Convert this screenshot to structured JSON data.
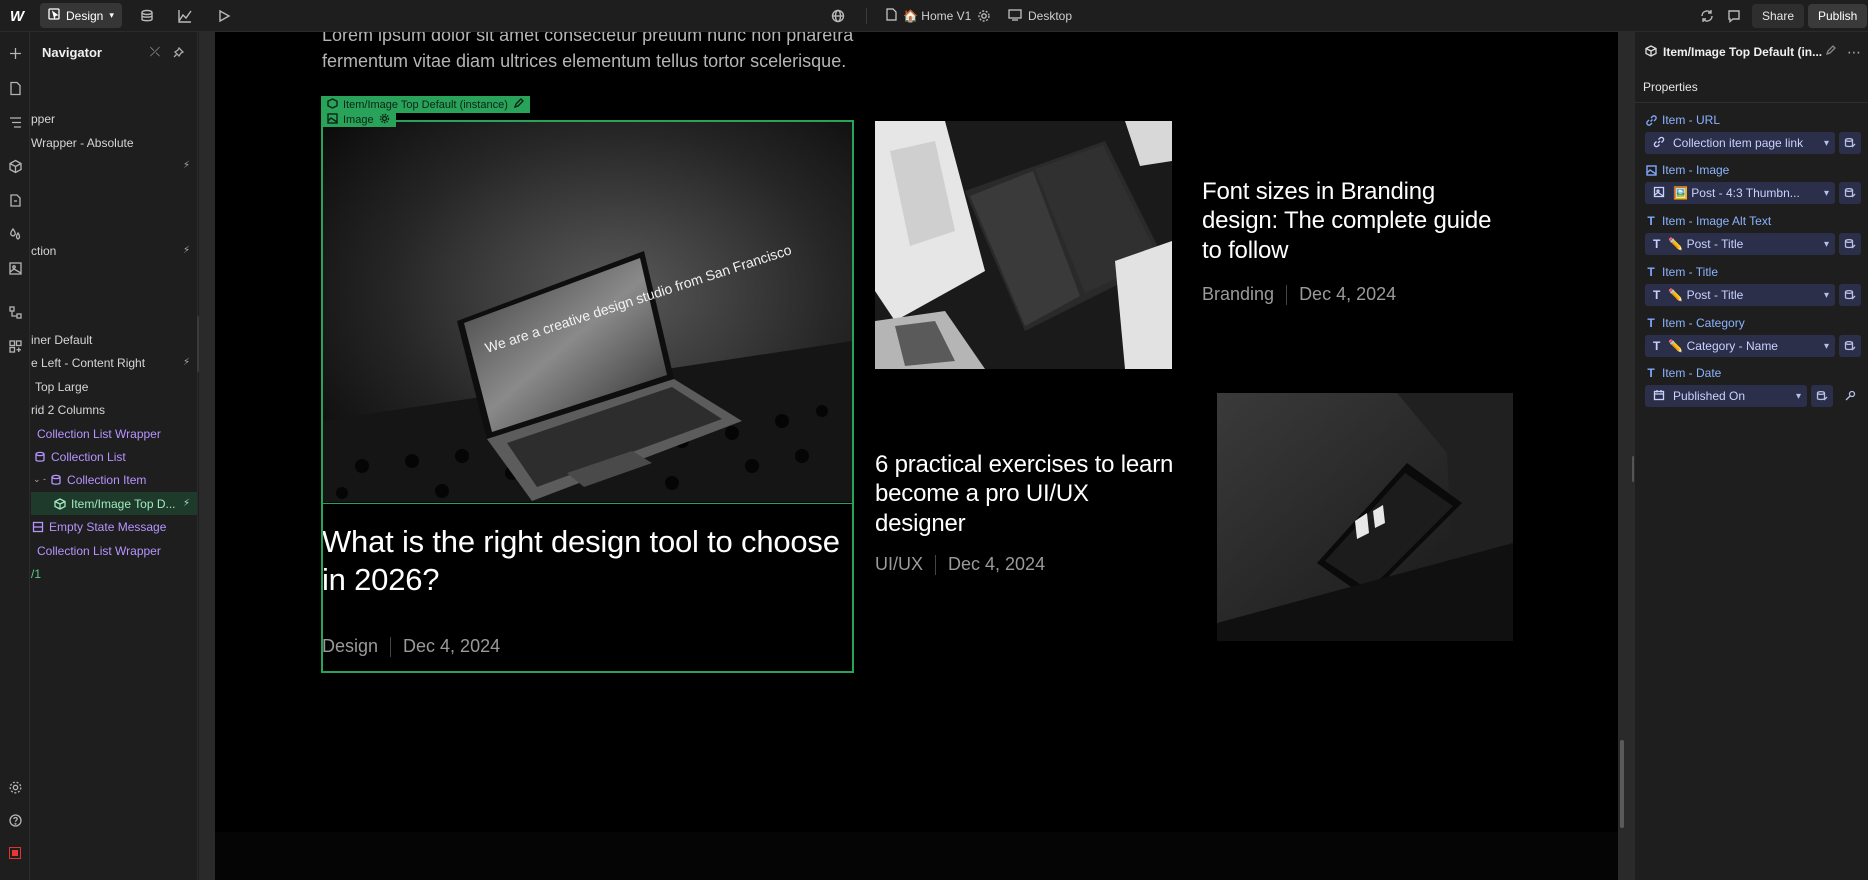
{
  "topbar": {
    "mode_label": "Design",
    "page_label": "🏠 Home V1",
    "breakpoint_label": "Desktop",
    "share_label": "Share",
    "publish_label": "Publish"
  },
  "navigator": {
    "title": "Navigator",
    "items": [
      {
        "label": "pper"
      },
      {
        "label": "Wrapper - Absolute"
      },
      {
        "label": "ction"
      },
      {
        "label": "iner Default"
      },
      {
        "label": "e Left - Content Right"
      },
      {
        "label": "Top Large"
      },
      {
        "label": "rid 2 Columns"
      },
      {
        "label": "Collection List Wrapper"
      },
      {
        "label": "Collection List"
      },
      {
        "label": "Collection Item"
      },
      {
        "label": "Item/Image Top D..."
      },
      {
        "label": "Empty State Message"
      },
      {
        "label": "Collection List Wrapper"
      },
      {
        "label": "/1"
      }
    ]
  },
  "canvas": {
    "intro_text": "Lorem ipsum dolor sit amet consectetur pretium nunc non pharetra fermentum vitae diam ultrices elementum tellus tortor scelerisque.",
    "selection_tag": "Item/Image Top Default (instance)",
    "image_tag": "Image",
    "laptop_screen_text": "We are a creative design studio from San Francisco",
    "posts": [
      {
        "title": "What is the right design tool to choose in 2026?",
        "category": "Design",
        "date": "Dec 4, 2024"
      },
      {
        "title": "Font sizes in Branding design: The complete guide to follow",
        "category": "Branding",
        "date": "Dec 4, 2024"
      },
      {
        "title": "6 practical exercises to learn become a pro UI/UX designer",
        "category": "UI/UX",
        "date": "Dec 4, 2024"
      }
    ]
  },
  "panel": {
    "title": "Item/Image Top Default (in...",
    "tab": "Properties",
    "props": [
      {
        "label": "Item - URL",
        "value": "Collection item page link"
      },
      {
        "label": "Item - Image",
        "value": "🖼️ Post - 4:3 Thumbn..."
      },
      {
        "label": "Item - Image Alt Text",
        "value": "✏️ Post - Title"
      },
      {
        "label": "Item - Title",
        "value": "✏️ Post - Title"
      },
      {
        "label": "Item - Category",
        "value": "✏️ Category - Name"
      },
      {
        "label": "Item - Date",
        "value": "Published On"
      }
    ]
  },
  "colors": {
    "selection": "#29a35a",
    "binding_field": "#2c2f4a",
    "binding_label": "#8bb3ff"
  }
}
